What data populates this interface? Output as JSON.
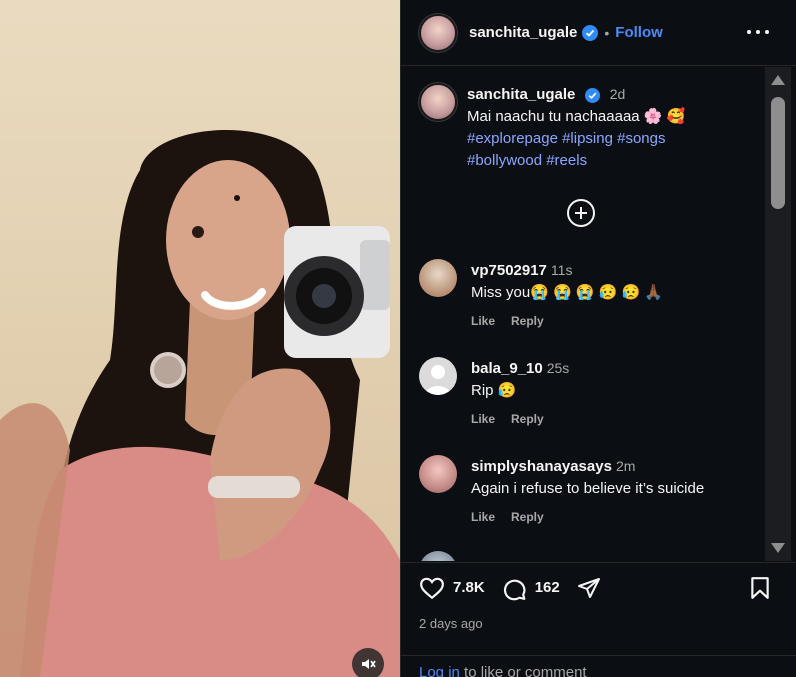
{
  "post": {
    "username": "sanchita_ugale",
    "follow_label": "Follow",
    "dot": "•",
    "caption_time": "2d",
    "caption_text": "Mai naachu tu nachaaaaa 🌸 🥰",
    "caption_tags": "#explorepage #lipsing #songs #bollywood #reels",
    "likes": "7.8K",
    "comments_count": "162",
    "posted_ago": "2 days ago",
    "login_link": "Log in",
    "login_suffix": " to like or comment"
  },
  "comments": [
    {
      "user": "vp7502917",
      "time": "11s",
      "text": "Miss you😭 😭 😭 😥 😥 🙏🏾",
      "like": "Like",
      "reply": "Reply"
    },
    {
      "user": "bala_9_10",
      "time": "25s",
      "text": "Rip 😥",
      "like": "Like",
      "reply": "Reply"
    },
    {
      "user": "simplyshanayasays",
      "time": "2m",
      "text": "Again i refuse to believe it’s suicide",
      "like": "Like",
      "reply": "Reply"
    }
  ],
  "colors": {
    "accent": "#4a8cf7",
    "hashtag": "#8aa6ff",
    "panel_bg": "#0b0f14"
  },
  "icons": [
    "verified-icon",
    "more-options-icon",
    "add-comment-icon",
    "heart-icon",
    "comment-icon",
    "share-icon",
    "bookmark-icon",
    "mute-icon"
  ]
}
